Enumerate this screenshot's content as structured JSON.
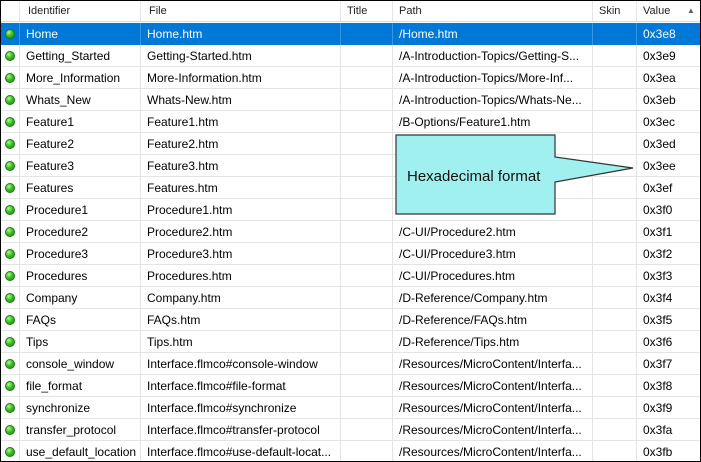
{
  "columns": [
    "Identifier",
    "File",
    "Title",
    "Path",
    "Skin",
    "Value"
  ],
  "scroll_up_glyph": "▲",
  "callout": {
    "text": "Hexadecimal format",
    "fill": "#9ff0ef"
  },
  "colors": {
    "selected": "#0078d7",
    "status_ok": "#3fbf26"
  },
  "rows": [
    {
      "identifier": "Home",
      "file": "Home.htm",
      "title": "",
      "path": "/Home.htm",
      "skin": "",
      "value": "0x3e8",
      "selected": true
    },
    {
      "identifier": "Getting_Started",
      "file": "Getting-Started.htm",
      "title": "",
      "path": "/A-Introduction-Topics/Getting-S...",
      "skin": "",
      "value": "0x3e9"
    },
    {
      "identifier": "More_Information",
      "file": "More-Information.htm",
      "title": "",
      "path": "/A-Introduction-Topics/More-Inf...",
      "skin": "",
      "value": "0x3ea"
    },
    {
      "identifier": "Whats_New",
      "file": "Whats-New.htm",
      "title": "",
      "path": "/A-Introduction-Topics/Whats-Ne...",
      "skin": "",
      "value": "0x3eb"
    },
    {
      "identifier": "Feature1",
      "file": "Feature1.htm",
      "title": "",
      "path": "/B-Options/Feature1.htm",
      "skin": "",
      "value": "0x3ec"
    },
    {
      "identifier": "Feature2",
      "file": "Feature2.htm",
      "title": "",
      "path": "",
      "skin": "",
      "value": "0x3ed"
    },
    {
      "identifier": "Feature3",
      "file": "Feature3.htm",
      "title": "",
      "path": "",
      "skin": "",
      "value": "0x3ee"
    },
    {
      "identifier": "Features",
      "file": "Features.htm",
      "title": "",
      "path": "",
      "skin": "",
      "value": "0x3ef"
    },
    {
      "identifier": "Procedure1",
      "file": "Procedure1.htm",
      "title": "",
      "path": "",
      "skin": "",
      "value": "0x3f0"
    },
    {
      "identifier": "Procedure2",
      "file": "Procedure2.htm",
      "title": "",
      "path": "/C-UI/Procedure2.htm",
      "skin": "",
      "value": "0x3f1"
    },
    {
      "identifier": "Procedure3",
      "file": "Procedure3.htm",
      "title": "",
      "path": "/C-UI/Procedure3.htm",
      "skin": "",
      "value": "0x3f2"
    },
    {
      "identifier": "Procedures",
      "file": "Procedures.htm",
      "title": "",
      "path": "/C-UI/Procedures.htm",
      "skin": "",
      "value": "0x3f3"
    },
    {
      "identifier": "Company",
      "file": "Company.htm",
      "title": "",
      "path": "/D-Reference/Company.htm",
      "skin": "",
      "value": "0x3f4"
    },
    {
      "identifier": "FAQs",
      "file": "FAQs.htm",
      "title": "",
      "path": "/D-Reference/FAQs.htm",
      "skin": "",
      "value": "0x3f5"
    },
    {
      "identifier": "Tips",
      "file": "Tips.htm",
      "title": "",
      "path": "/D-Reference/Tips.htm",
      "skin": "",
      "value": "0x3f6"
    },
    {
      "identifier": "console_window",
      "file": "Interface.flmco#console-window",
      "title": "",
      "path": "/Resources/MicroContent/Interfa...",
      "skin": "",
      "value": "0x3f7"
    },
    {
      "identifier": "file_format",
      "file": "Interface.flmco#file-format",
      "title": "",
      "path": "/Resources/MicroContent/Interfa...",
      "skin": "",
      "value": "0x3f8"
    },
    {
      "identifier": "synchronize",
      "file": "Interface.flmco#synchronize",
      "title": "",
      "path": "/Resources/MicroContent/Interfa...",
      "skin": "",
      "value": "0x3f9"
    },
    {
      "identifier": "transfer_protocol",
      "file": "Interface.flmco#transfer-protocol",
      "title": "",
      "path": "/Resources/MicroContent/Interfa...",
      "skin": "",
      "value": "0x3fa"
    },
    {
      "identifier": "use_default_location",
      "file": "Interface.flmco#use-default-locat...",
      "title": "",
      "path": "/Resources/MicroContent/Interfa...",
      "skin": "",
      "value": "0x3fb"
    }
  ]
}
